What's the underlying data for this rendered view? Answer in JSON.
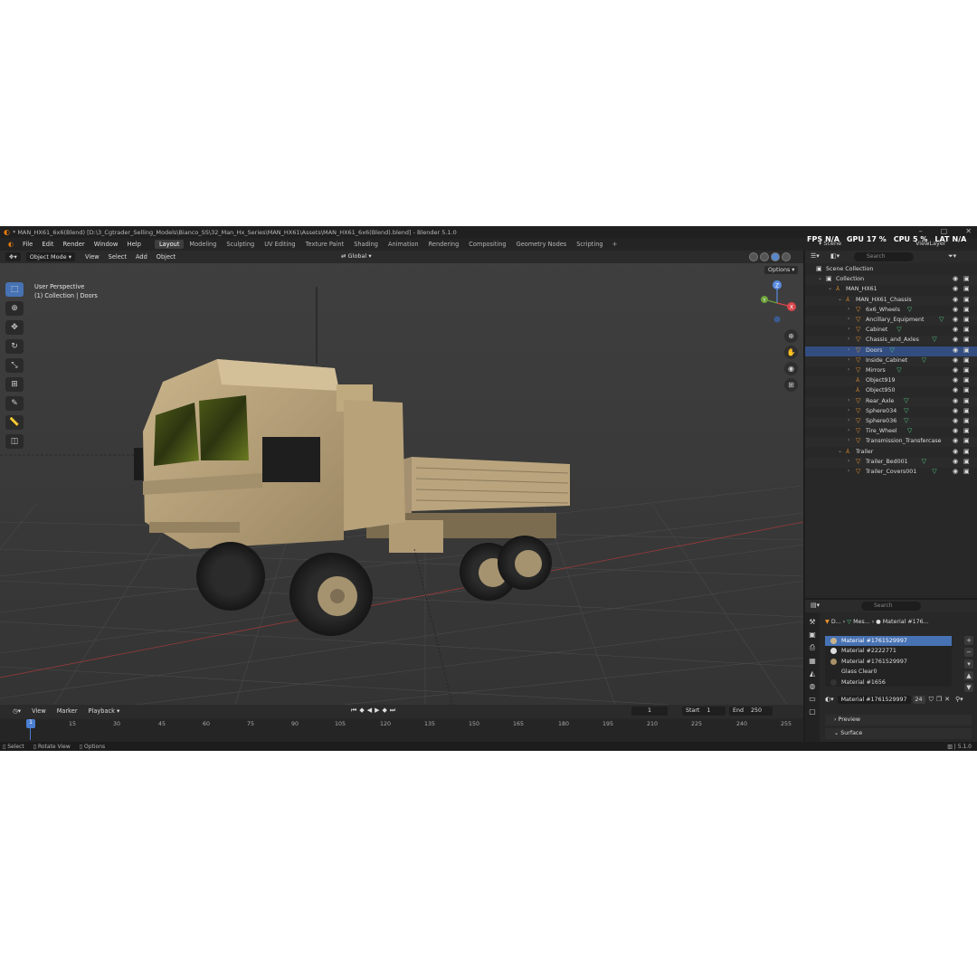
{
  "window": {
    "title": "* MAN_HX61_6x6(Blend) [D:\\3_Cgtrader_Selling_Models\\Bianco_SS\\32_Man_Hx_Series\\MAN_HX61\\Assets\\MAN_HX61_6x6(Blend).blend] - Blender 5.1.0"
  },
  "menu": {
    "items": [
      "File",
      "Edit",
      "Render",
      "Window",
      "Help"
    ],
    "workspaces": [
      "Layout",
      "Modeling",
      "Sculpting",
      "UV Editing",
      "Texture Paint",
      "Shading",
      "Animation",
      "Rendering",
      "Compositing",
      "Geometry Nodes",
      "Scripting"
    ],
    "active_workspace": "Layout",
    "plus": "+"
  },
  "hud": {
    "fps_label": "FPS",
    "fps_value": "N/A",
    "gpu_label": "GPU",
    "gpu_value": "17 %",
    "cpu_label": "CPU",
    "cpu_value": "5 %",
    "lat_label": "LAT",
    "lat_value": "N/A"
  },
  "scene_field": "Scene",
  "viewlayer_field": "ViewLayer",
  "viewport": {
    "mode": "Object Mode",
    "menus": [
      "View",
      "Select",
      "Add",
      "Object"
    ],
    "orientation": "Global",
    "options": "Options",
    "perspective": "User Perspective",
    "context": "(1) Collection | Doors",
    "gizmo_axes": [
      "Z",
      "Y",
      "X"
    ]
  },
  "timeline": {
    "menus": [
      "View",
      "Marker",
      "Playback"
    ],
    "current_frame": "1",
    "start_label": "Start",
    "start_value": "1",
    "end_label": "End",
    "end_value": "250",
    "cursor": "1",
    "ticks": [
      "15",
      "30",
      "45",
      "60",
      "75",
      "90",
      "105",
      "120",
      "135",
      "150",
      "165",
      "180",
      "195",
      "210",
      "225",
      "240",
      "255"
    ]
  },
  "statusbar": {
    "items": [
      "Select",
      "Rotate View",
      "Options"
    ],
    "version": "5.1.0"
  },
  "outliner": {
    "search_placeholder": "Search",
    "rows": [
      {
        "label": "Scene Collection",
        "depth": 0,
        "icon": "collection"
      },
      {
        "label": "Collection",
        "depth": 1,
        "icon": "collection"
      },
      {
        "label": "MAN_HX61",
        "depth": 2,
        "icon": "empty"
      },
      {
        "label": "MAN_HX61_Chassis",
        "depth": 3,
        "icon": "empty"
      },
      {
        "label": "6x6_Wheels",
        "depth": 4,
        "icon": "mesh",
        "modifier": true
      },
      {
        "label": "Ancillary_Equipment",
        "depth": 4,
        "icon": "mesh",
        "modifier": true
      },
      {
        "label": "Cabinet",
        "depth": 4,
        "icon": "mesh",
        "modifier": true
      },
      {
        "label": "Chassis_and_Axles",
        "depth": 4,
        "icon": "mesh",
        "modifier": true
      },
      {
        "label": "Doors",
        "depth": 4,
        "icon": "mesh",
        "modifier": true,
        "selected": true
      },
      {
        "label": "Inside_Cabinet",
        "depth": 4,
        "icon": "mesh",
        "modifier": true
      },
      {
        "label": "Mirrors",
        "depth": 4,
        "icon": "mesh",
        "modifier": true
      },
      {
        "label": "Object919",
        "depth": 4,
        "icon": "empty"
      },
      {
        "label": "Object950",
        "depth": 4,
        "icon": "empty"
      },
      {
        "label": "Rear_Axle",
        "depth": 4,
        "icon": "mesh",
        "modifier": true
      },
      {
        "label": "Sphere034",
        "depth": 4,
        "icon": "mesh",
        "modifier": true
      },
      {
        "label": "Sphere036",
        "depth": 4,
        "icon": "mesh",
        "modifier": true
      },
      {
        "label": "Tire_Wheel",
        "depth": 4,
        "icon": "mesh",
        "modifier": true
      },
      {
        "label": "Transmission_Transfercase",
        "depth": 4,
        "icon": "mesh"
      },
      {
        "label": "Trailer",
        "depth": 3,
        "icon": "empty"
      },
      {
        "label": "Trailer_Bed001",
        "depth": 4,
        "icon": "mesh",
        "modifier": true
      },
      {
        "label": "Trailer_Covers001",
        "depth": 4,
        "icon": "mesh",
        "modifier": true
      }
    ]
  },
  "properties": {
    "search_placeholder": "Search",
    "breadcrumb": [
      "D...",
      "Mes...",
      "Material #176..."
    ],
    "materials": [
      {
        "name": "Material #1761529997",
        "selected": true
      },
      {
        "name": "Material #2222771"
      },
      {
        "name": "Material #1761529997"
      },
      {
        "name": "Glass Clear0"
      },
      {
        "name": "Material #1656"
      }
    ],
    "active_material": "Material #1761529997",
    "users": "24",
    "panels": [
      "Preview",
      "Surface"
    ]
  },
  "colors": {
    "accent": "#4772b3",
    "selection": "#334d80",
    "modifier_icon": "#52c882",
    "object_icon": "#e8912d",
    "viewport_bg": "#393939"
  }
}
